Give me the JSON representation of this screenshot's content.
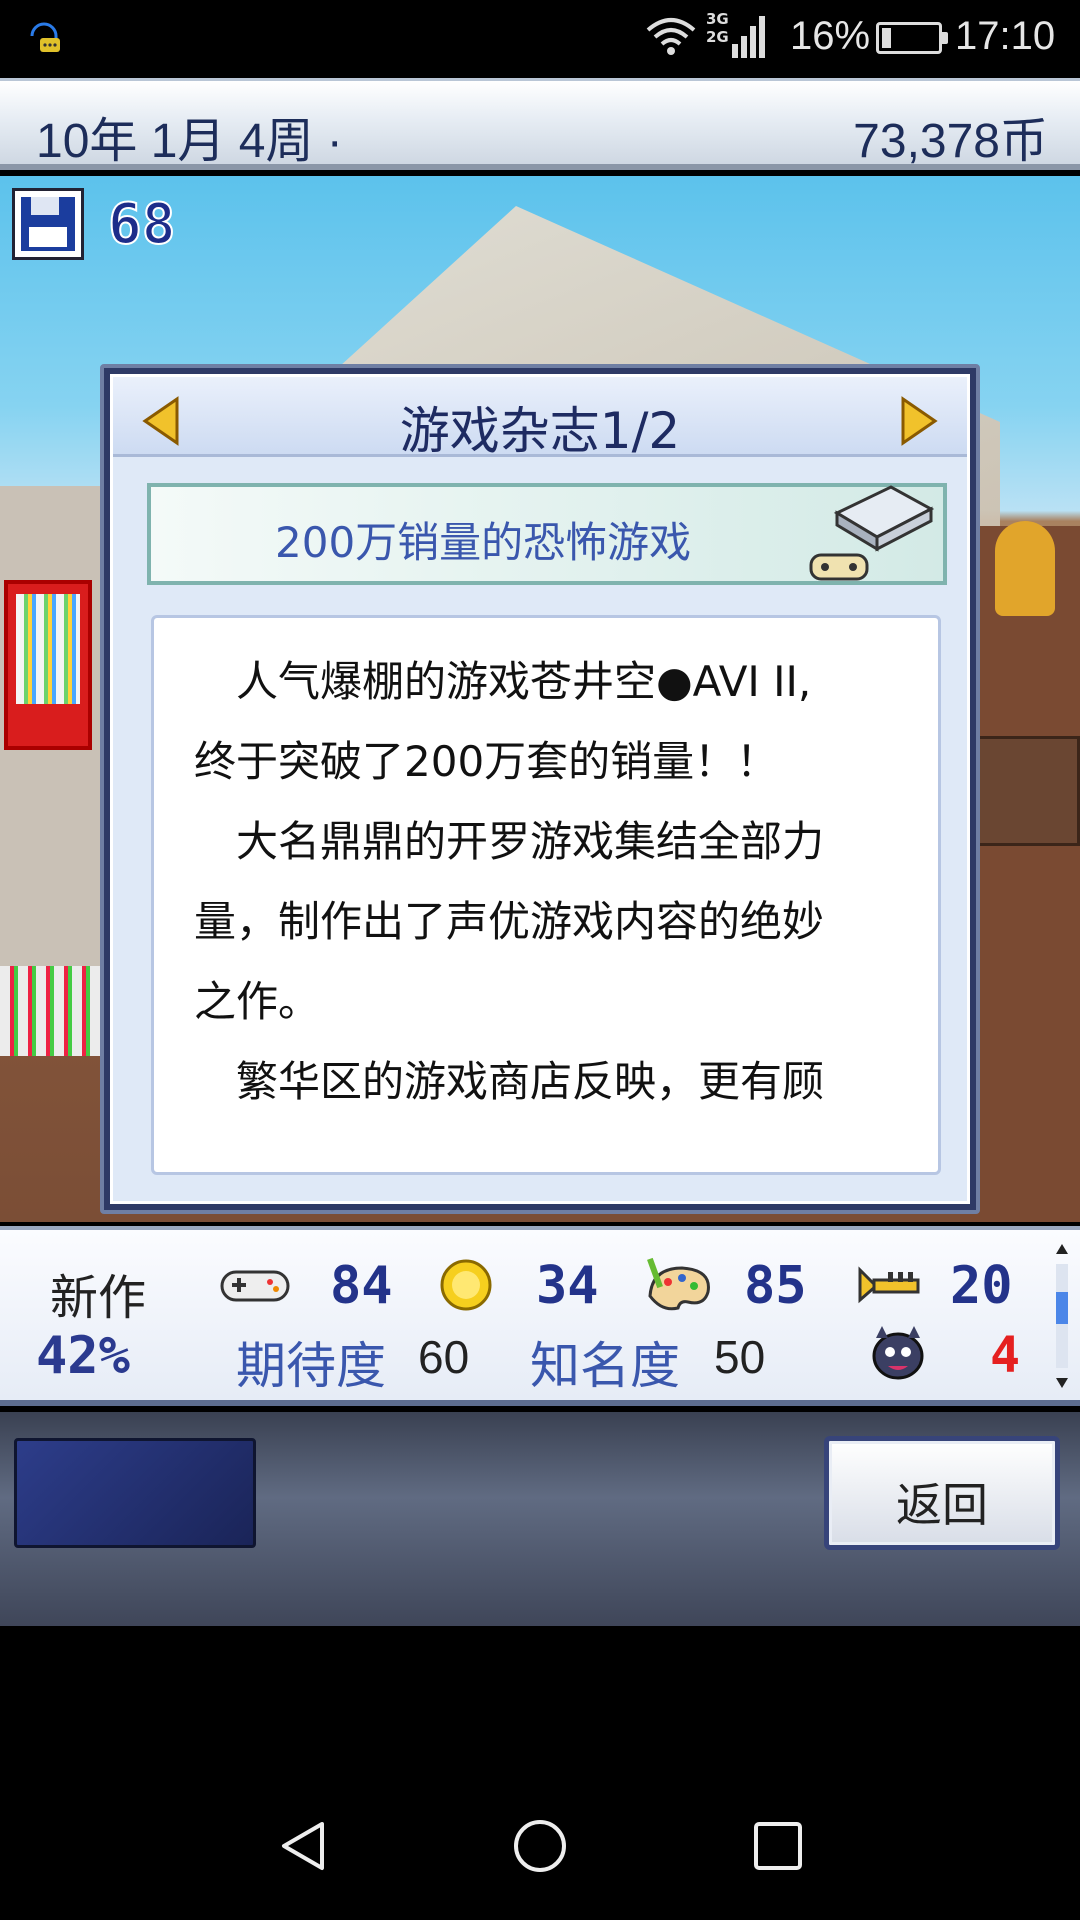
{
  "status_bar": {
    "network": [
      "3G",
      "2G"
    ],
    "battery": "16%",
    "battery_level": 0.16,
    "time": "17:10"
  },
  "header": {
    "date": "10年 1月 4周 ·",
    "money": "73,378币"
  },
  "hud": {
    "save_count": "68"
  },
  "dialog": {
    "title": "游戏杂志1/2",
    "headline": "200万销量的恐怖游戏",
    "paragraphs": [
      "　人气爆棚的游戏苍井空●AVI II,",
      "终于突破了200万套的销量！！",
      "　大名鼎鼎的开罗游戏集结全部力",
      "量，制作出了声优游戏内容的绝妙",
      "之作。",
      "　繁华区的游戏商店反映，更有顾"
    ]
  },
  "stats": {
    "new_label": "新作",
    "new_pct": "42%",
    "fun": "84",
    "creativity": "34",
    "graphics": "85",
    "sound": "20",
    "expectation_label": "期待度",
    "expectation_value": "60",
    "fame_label": "知名度",
    "fame_value": "50",
    "bugs": "4"
  },
  "bottom": {
    "back_label": "返回"
  },
  "icons": {
    "left_arrow": "left-arrow-icon",
    "right_arrow": "right-arrow-icon",
    "console": "game-console-icon",
    "controller": "controller-icon",
    "coin": "coin-icon",
    "palette": "palette-icon",
    "trumpet": "trumpet-icon",
    "bug": "bug-icon"
  },
  "colors": {
    "accent": "#3a57ad",
    "title": "#1e2b62",
    "bug_red": "#e52020"
  }
}
